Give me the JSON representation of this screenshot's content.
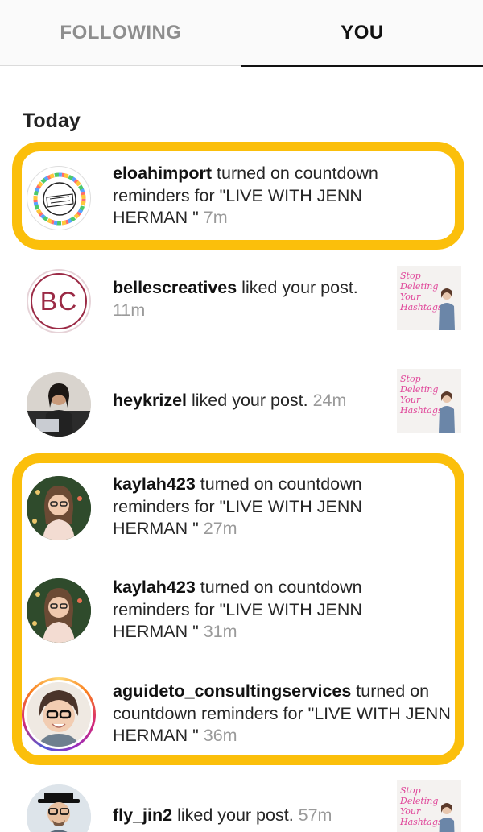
{
  "tabs": {
    "following": "FOLLOWING",
    "you": "YOU"
  },
  "section": {
    "today": "Today"
  },
  "thumbnail": {
    "text": "Stop Deleting Your Hashtags!!!"
  },
  "notifications": [
    {
      "user": "eloahimport",
      "action": " turned on countdown reminders for \"LIVE WITH JENN HERMAN \"",
      "time": " 7m",
      "avatar": "eloahimport-logo-avatar"
    },
    {
      "user": "bellescreatives",
      "action": " liked your post.",
      "time": " 11m",
      "avatar": "bc-monogram-avatar",
      "avatar_text": "BC"
    },
    {
      "user": "heykrizel",
      "action": " liked your post.",
      "time": " 24m",
      "avatar": "photo-avatar"
    },
    {
      "user": "kaylah423",
      "action": " turned on countdown reminders for \"LIVE WITH JENN HERMAN \"",
      "time": " 27m",
      "avatar": "photo-avatar"
    },
    {
      "user": "kaylah423",
      "action": " turned on countdown reminders for \"LIVE WITH JENN HERMAN \"",
      "time": " 31m",
      "avatar": "photo-avatar"
    },
    {
      "user": "aguideto_consultingservices",
      "action": " turned on countdown reminders for \"LIVE WITH JENN HERMAN \"",
      "time": " 36m",
      "avatar": "story-ring-photo-avatar"
    },
    {
      "user": "fly_jin2",
      "action": " liked your post.",
      "time": " 57m",
      "avatar": "photo-avatar"
    }
  ],
  "colors": {
    "highlight": "#fbbf0b",
    "brand_bc": "#9b2a45",
    "thumbnail_text": "#e0479a"
  }
}
